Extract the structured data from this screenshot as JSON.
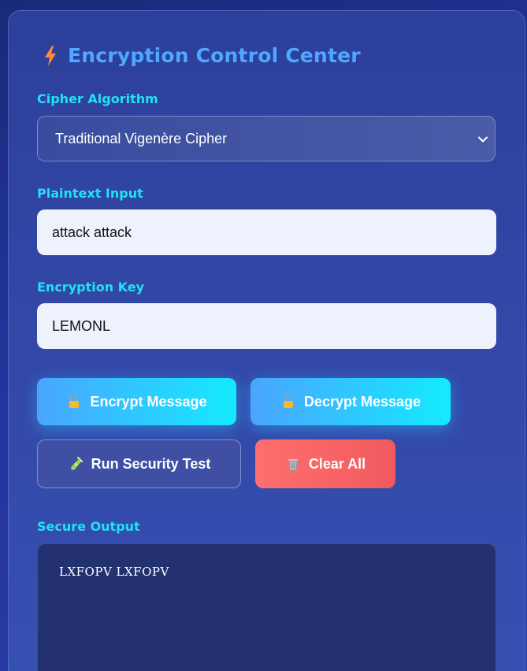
{
  "header": {
    "title": "Encryption Control Center",
    "icon": "lightning-bolt-icon"
  },
  "cipher": {
    "label": "Cipher Algorithm",
    "selected": "Traditional Vigenère Cipher"
  },
  "plaintext": {
    "label": "Plaintext Input",
    "value": "attack attack"
  },
  "key": {
    "label": "Encryption Key",
    "value": "LEMONL"
  },
  "buttons": {
    "encrypt": "Encrypt Message",
    "decrypt": "Decrypt Message",
    "test": "Run Security Test",
    "clear": "Clear All"
  },
  "output": {
    "label": "Secure Output",
    "value": "LXFOPV LXFOPV"
  },
  "colors": {
    "title": "#4fa8ff",
    "label": "#22e0f5",
    "button_gradient_start": "#4aa5ff",
    "button_gradient_end": "#14eaff",
    "clear_button": "#ff6f70"
  }
}
